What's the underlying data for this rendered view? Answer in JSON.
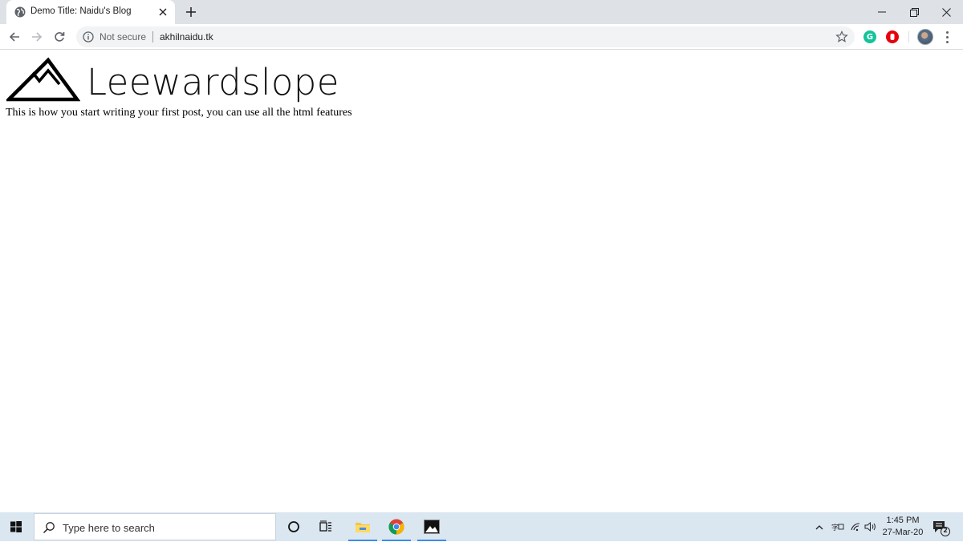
{
  "browser": {
    "tab_title": "Demo Title: Naidu's Blog",
    "security_label": "Not secure",
    "url": "akhilnaidu.tk"
  },
  "page": {
    "logo_text": "Leewardslope",
    "post_text": "This is how you start writing your first post, you can use all the html features"
  },
  "taskbar": {
    "search_placeholder": "Type here to search",
    "time": "1:45 PM",
    "date": "27-Mar-20",
    "notification_count": "2"
  },
  "colors": {
    "tabstrip_bg": "#dee1e6",
    "taskbar_bg": "#dae6f0",
    "grammarly_green": "#15c39a",
    "adblock_red": "#e8000b"
  }
}
